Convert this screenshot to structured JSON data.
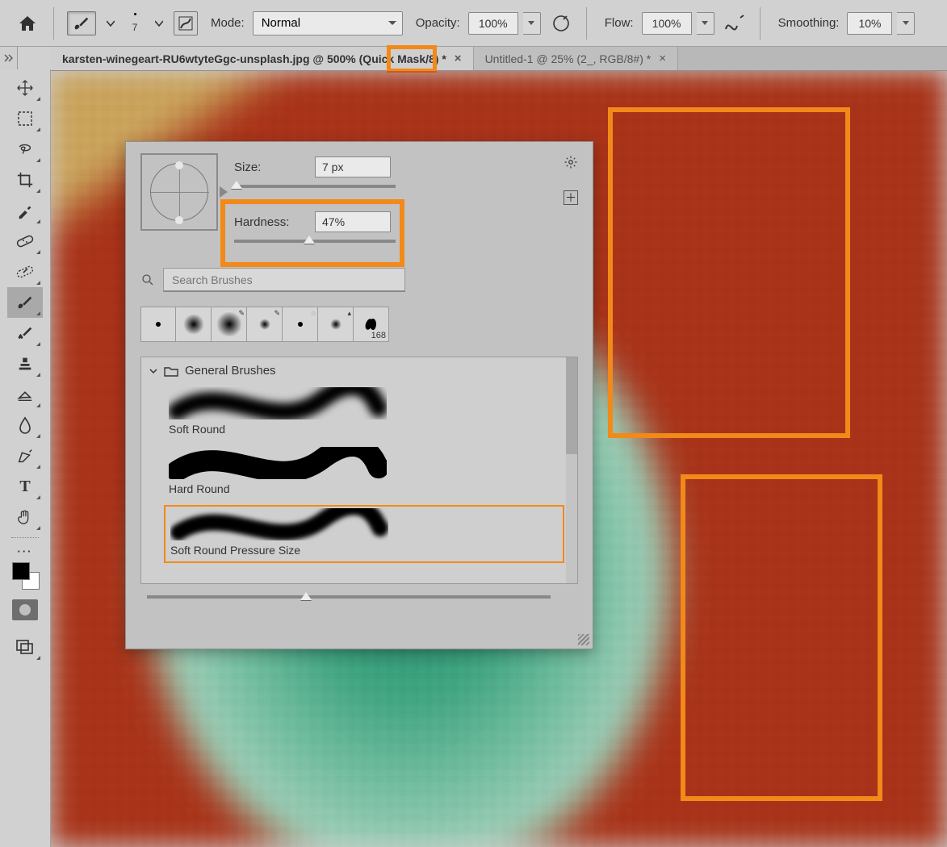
{
  "options_bar": {
    "brush_size_indicator": "7",
    "mode_label": "Mode:",
    "mode_value": "Normal",
    "opacity_label": "Opacity:",
    "opacity_value": "100%",
    "flow_label": "Flow:",
    "flow_value": "100%",
    "smoothing_label": "Smoothing:",
    "smoothing_value": "10%"
  },
  "tabs": [
    {
      "label_prefix": "karsten-winegeart-RU6wtyteGgc-unsplash.jpg @ ",
      "zoom": "500%",
      "label_suffix": " (Quick Mask/8) *",
      "active": true
    },
    {
      "label": "Untitled-1 @ 25% (2_, RGB/8#) *",
      "active": false
    }
  ],
  "brush_panel": {
    "size_label": "Size:",
    "size_value": "7 px",
    "hardness_label": "Hardness:",
    "hardness_value": "47%",
    "search_placeholder": "Search Brushes",
    "recent_last_label": "168",
    "group_title": "General Brushes",
    "presets": [
      {
        "name": "Soft Round"
      },
      {
        "name": "Hard Round"
      },
      {
        "name": "Soft Round Pressure Size"
      }
    ]
  },
  "colors": {
    "highlight": "#f28918"
  }
}
